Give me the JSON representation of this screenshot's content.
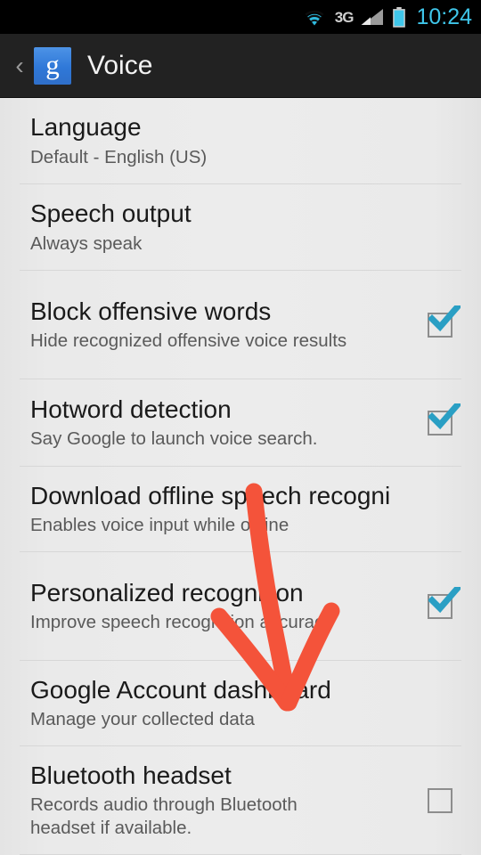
{
  "statusbar": {
    "network_label": "3G",
    "clock": "10:24",
    "icons": [
      "wifi-icon",
      "3g-icon",
      "signal-bars-icon",
      "battery-icon"
    ],
    "clock_color": "#3fc6ea"
  },
  "actionbar": {
    "back_chevron": "‹",
    "app_logo_letter": "g",
    "title": "Voice",
    "logo_color": "#3a7fd5"
  },
  "settings": {
    "rows": [
      {
        "title": "Language",
        "summary": "Default - English (US)",
        "widget": "none",
        "checked": false,
        "truncated": false
      },
      {
        "title": "Speech output",
        "summary": "Always speak",
        "widget": "none",
        "checked": false,
        "truncated": false
      },
      {
        "title": "Block offensive words",
        "summary": "Hide recognized offensive voice results",
        "widget": "checkbox",
        "checked": true,
        "truncated": false
      },
      {
        "title": "Hotword detection",
        "summary": "Say Google to launch voice search.",
        "widget": "checkbox",
        "checked": true,
        "truncated": false
      },
      {
        "title": "Download offline speech recogni",
        "summary": "Enables voice input while offline",
        "widget": "none",
        "checked": false,
        "truncated": true
      },
      {
        "title": "Personalized recognition",
        "summary": "Improve speech recognition accuracy",
        "widget": "checkbox",
        "checked": true,
        "truncated": false
      },
      {
        "title": "Google Account dashboard",
        "summary": "Manage your collected data",
        "widget": "none",
        "checked": false,
        "truncated": false
      },
      {
        "title": "Bluetooth headset",
        "summary": "Records audio through Bluetooth headset if available.",
        "widget": "checkbox",
        "checked": false,
        "truncated": false
      }
    ]
  },
  "annotation": {
    "type": "hand-drawn-arrow",
    "color": "#f4533a",
    "points_to": "Google Account dashboard"
  }
}
